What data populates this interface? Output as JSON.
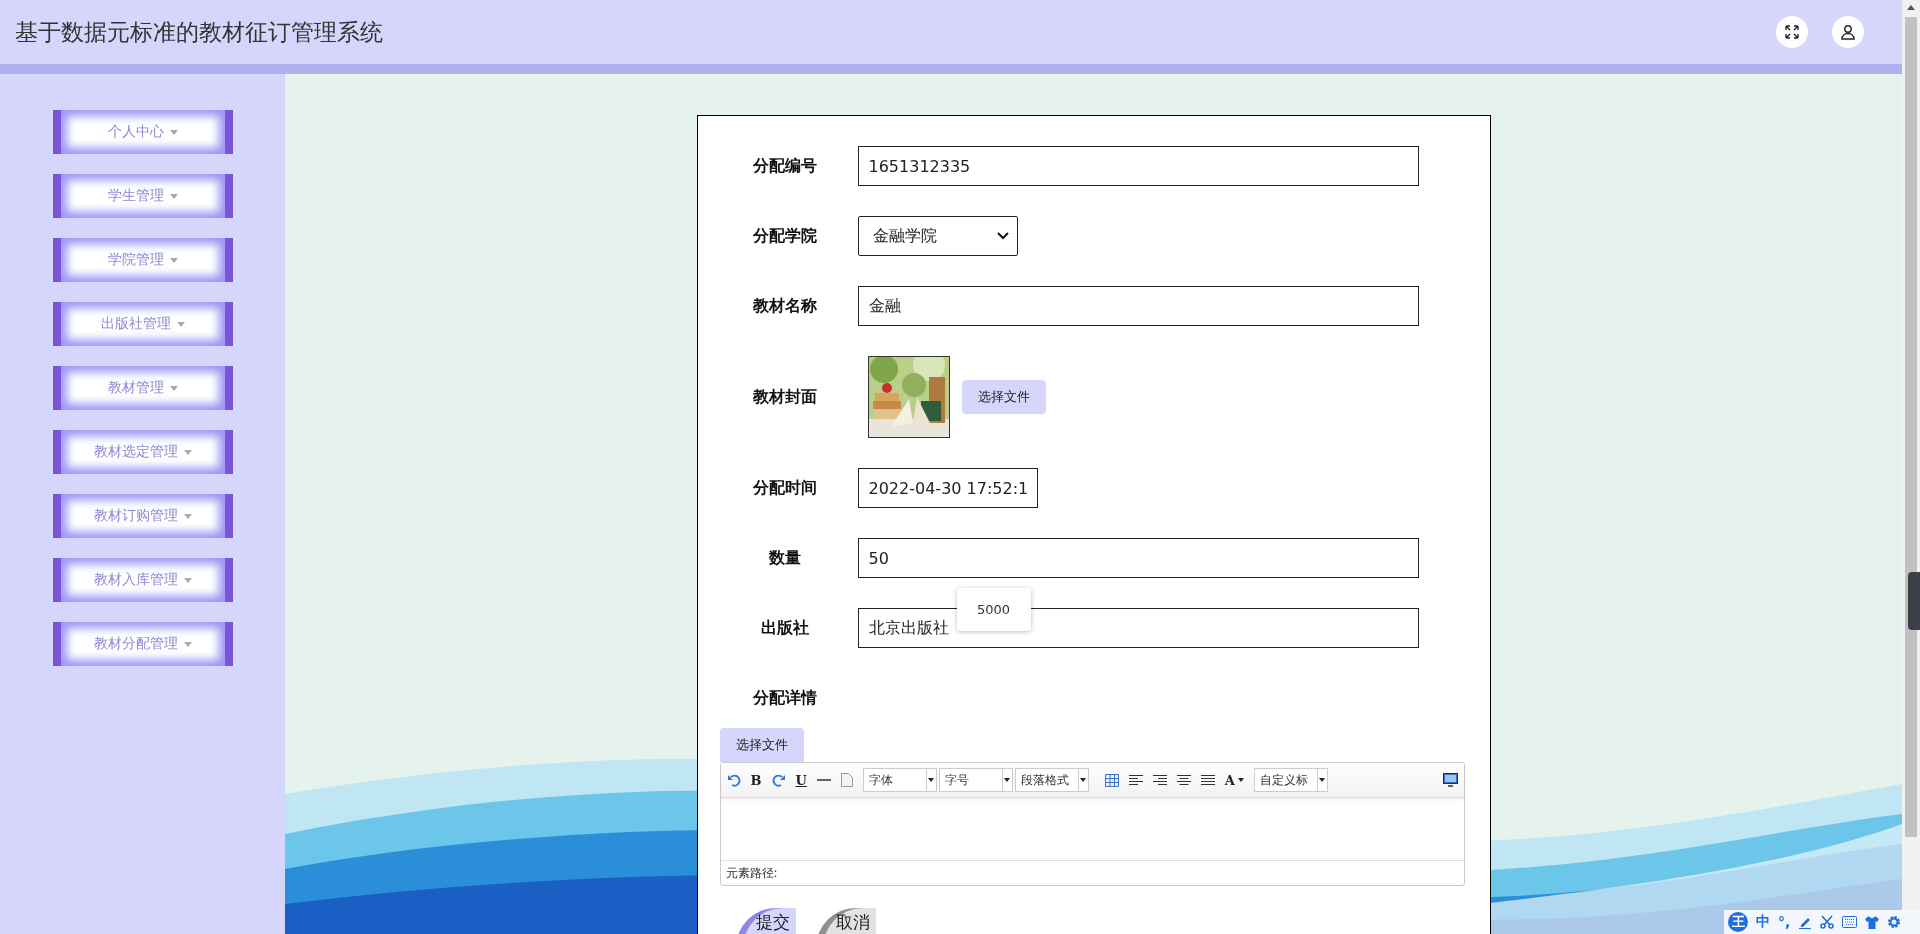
{
  "header": {
    "title": "基于数据元标准的教材征订管理系统"
  },
  "sidebar": {
    "items": [
      {
        "label": "个人中心"
      },
      {
        "label": "学生管理"
      },
      {
        "label": "学院管理"
      },
      {
        "label": "出版社管理"
      },
      {
        "label": "教材管理"
      },
      {
        "label": "教材选定管理"
      },
      {
        "label": "教材订购管理"
      },
      {
        "label": "教材入库管理"
      },
      {
        "label": "教材分配管理"
      }
    ]
  },
  "form": {
    "fields": [
      {
        "kind": "text",
        "label": "分配编号",
        "value": "1651312335"
      },
      {
        "kind": "select",
        "label": "分配学院",
        "value": "金融学院"
      },
      {
        "kind": "text",
        "label": "教材名称",
        "value": "金融"
      },
      {
        "label": "教材封面",
        "button": "选择文件"
      },
      {
        "kind": "datetime",
        "label": "分配时间",
        "value": "2022-04-30 17:52:1"
      },
      {
        "kind": "text",
        "label": "数量",
        "value": "50",
        "suggestion": "5000"
      },
      {
        "kind": "text",
        "label": "出版社",
        "value": "北京出版社"
      }
    ],
    "details": {
      "label": "分配详情",
      "upload_button": "选择文件",
      "editor": {
        "toolbar": {
          "bold": "B",
          "underline": "U",
          "font_color": "A",
          "selects": [
            "字体",
            "字号",
            "段落格式"
          ],
          "heading": "自定义标"
        },
        "status": "元素路径:"
      }
    },
    "buttons": [
      {
        "kind": "primary",
        "label": "提交"
      },
      {
        "kind": "secondary",
        "label": "取消"
      }
    ]
  },
  "ime_bar": {
    "logo": "王",
    "mode": "中",
    "punctuation": "°,"
  }
}
